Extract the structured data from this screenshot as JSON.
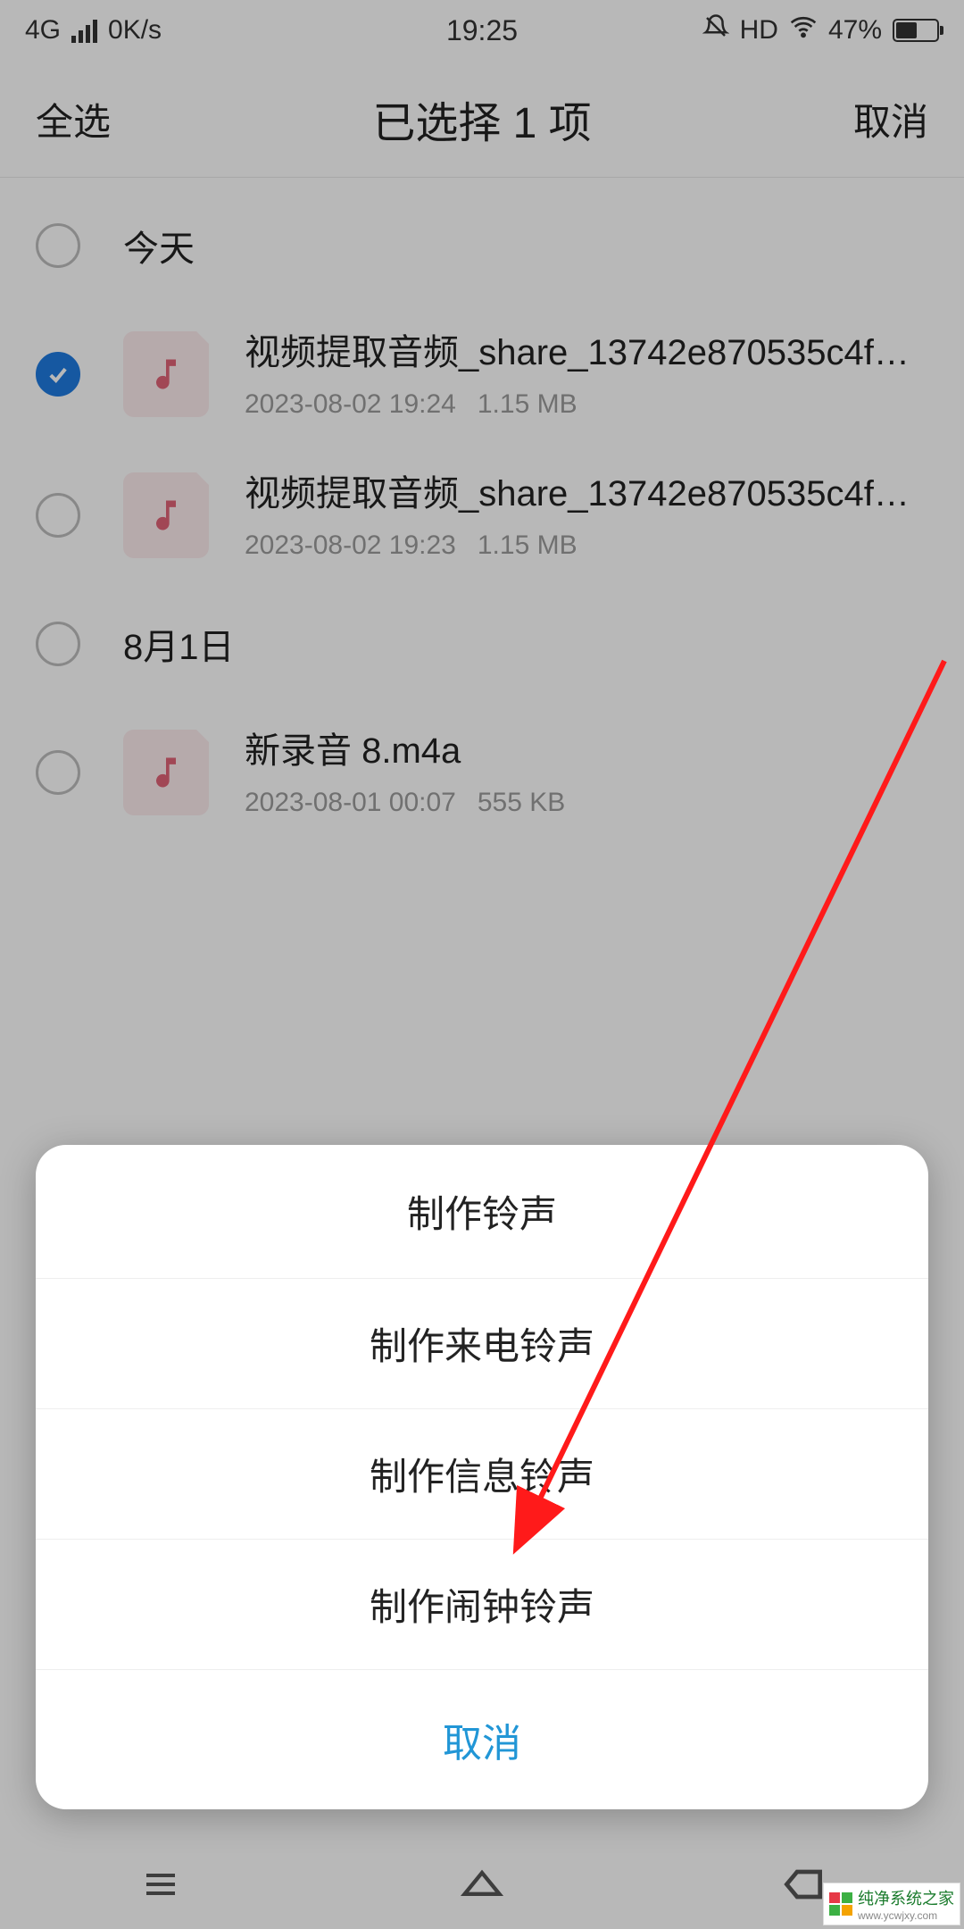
{
  "status": {
    "network": "4G",
    "speed": "0K/s",
    "time": "19:25",
    "hd": "HD",
    "battery_pct": "47%"
  },
  "header": {
    "select_all": "全选",
    "title": "已选择 1 项",
    "cancel": "取消"
  },
  "sections": [
    {
      "label": "今天",
      "checked": false
    },
    {
      "label": "8月1日",
      "checked": false
    }
  ],
  "files": [
    {
      "checked": true,
      "name": "视频提取音频_share_13742e870535c4f…",
      "date": "2023-08-02 19:24",
      "size": "1.15 MB"
    },
    {
      "checked": false,
      "name": "视频提取音频_share_13742e870535c4f…",
      "date": "2023-08-02 19:23",
      "size": "1.15 MB"
    },
    {
      "checked": false,
      "name": "新录音 8.m4a",
      "date": "2023-08-01 00:07",
      "size": "555 KB"
    }
  ],
  "modal": {
    "title": "制作铃声",
    "opt1": "制作来电铃声",
    "opt2": "制作信息铃声",
    "opt3": "制作闹钟铃声",
    "cancel": "取消"
  },
  "watermark": {
    "title": "纯净系统之家",
    "url": "www.ycwjxy.com"
  }
}
